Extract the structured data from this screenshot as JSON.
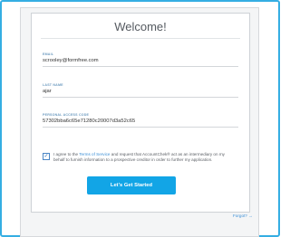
{
  "window": {
    "title": "Welcome!"
  },
  "form": {
    "email": {
      "label": "EMAIL",
      "value": "scrooley@formfree.com"
    },
    "last_name": {
      "label": "LAST NAME",
      "value": "ajar"
    },
    "access_code": {
      "label": "PERSONAL ACCESS CODE",
      "value": "57302bba6c65e71280c20007d3a52c65"
    },
    "consent": {
      "checked": true,
      "before": "I agree to the ",
      "terms_link": "Terms of Service",
      "after": " and request that AccountChek® act as an intermediary on my behalf to furnish information to a prospective creditor in order to further my application."
    },
    "cta_label": "Let's Get Started"
  },
  "footer": {
    "forgot_label": "Forgot? →"
  },
  "colors": {
    "accent": "#12a5e6",
    "frame": "#35aee3",
    "link": "#3b8fd6"
  }
}
